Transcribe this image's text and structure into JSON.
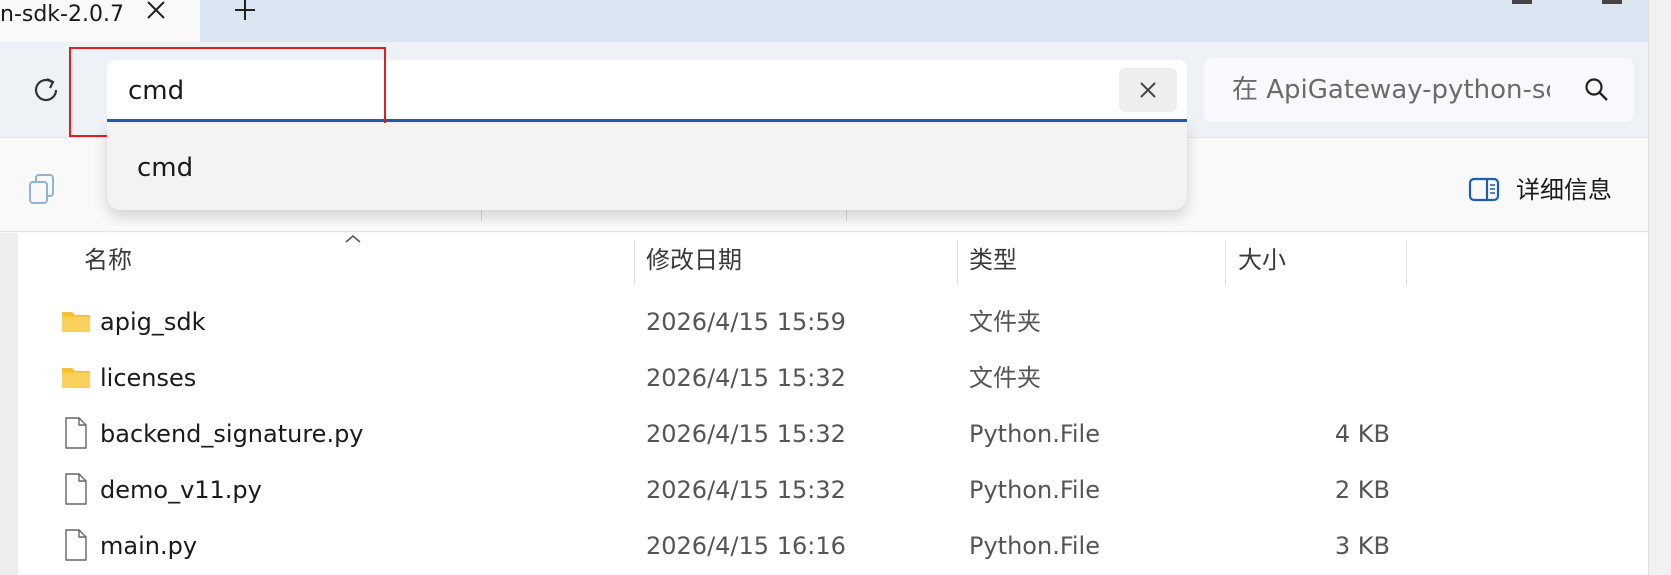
{
  "tab": {
    "title": "n-sdk-2.0.7",
    "close_icon": "close-icon",
    "new_tab_icon": "plus-icon"
  },
  "address_bar": {
    "value": "cmd",
    "clear_icon": "close-icon",
    "refresh_icon": "refresh-icon"
  },
  "suggestion": {
    "item": "cmd"
  },
  "search": {
    "placeholder": "在 ApiGateway-python-sc",
    "icon": "search-icon"
  },
  "toolbar": {
    "copy_icon": "copy-icon",
    "details_icon": "details-pane-icon",
    "details_label": "详细信息"
  },
  "columns": {
    "name": "名称",
    "date": "修改日期",
    "type": "类型",
    "size": "大小"
  },
  "files": [
    {
      "name": "apig_sdk",
      "date": "2026/4/15 15:59",
      "type": "文件夹",
      "size": "",
      "icon": "folder-icon"
    },
    {
      "name": "licenses",
      "date": "2026/4/15 15:32",
      "type": "文件夹",
      "size": "",
      "icon": "folder-icon"
    },
    {
      "name": "backend_signature.py",
      "date": "2026/4/15 15:32",
      "type": "Python.File",
      "size": "4 KB",
      "icon": "file-icon"
    },
    {
      "name": "demo_v11.py",
      "date": "2026/4/15 15:32",
      "type": "Python.File",
      "size": "2 KB",
      "icon": "file-icon"
    },
    {
      "name": "main.py",
      "date": "2026/4/15 16:16",
      "type": "Python.File",
      "size": "3 KB",
      "icon": "file-icon"
    }
  ],
  "colors": {
    "accent": "#1d5fae",
    "highlight_box": "#e02020",
    "tabstrip": "#d9e5f1",
    "folder": "#f5c33b"
  }
}
